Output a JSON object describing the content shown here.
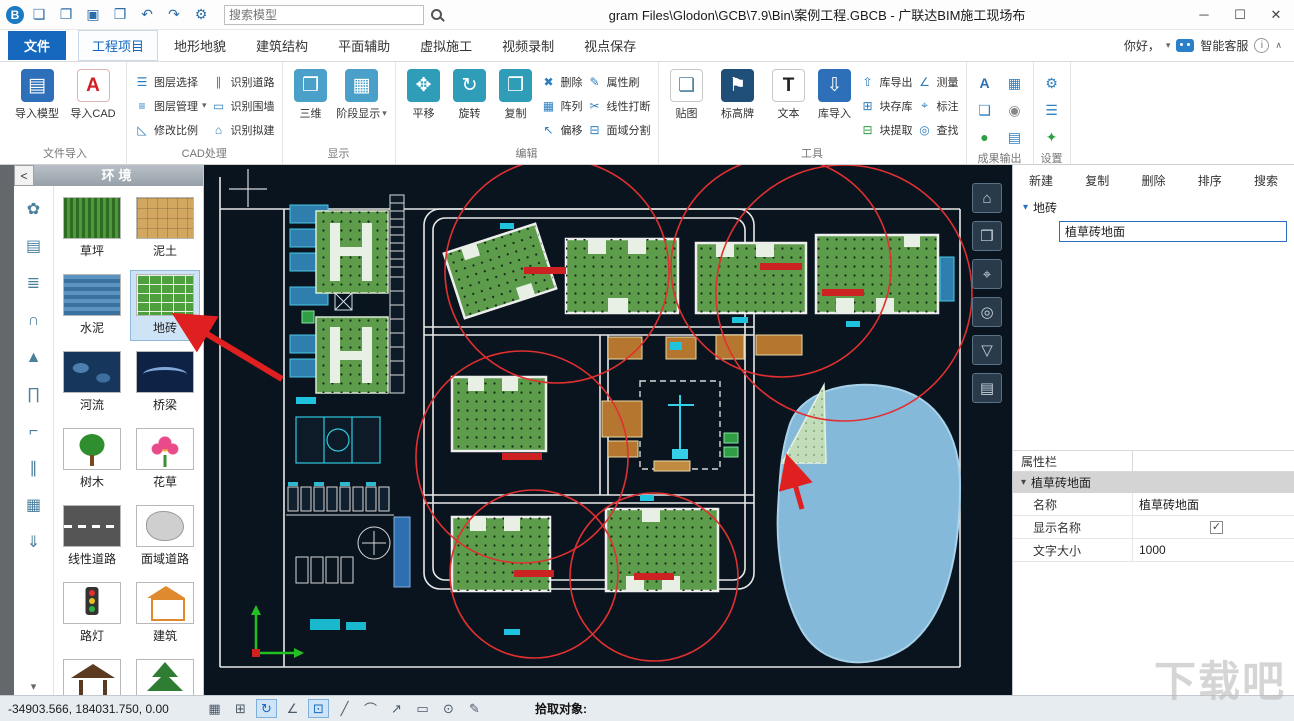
{
  "titlebar": {
    "logo": "B",
    "quick": [
      {
        "name": "new-file",
        "glyph": "❏"
      },
      {
        "name": "open-file",
        "glyph": "❐"
      },
      {
        "name": "save",
        "glyph": "▣"
      },
      {
        "name": "save-as",
        "glyph": "❒"
      },
      {
        "name": "undo",
        "glyph": "↶"
      },
      {
        "name": "redo",
        "glyph": "↷"
      },
      {
        "name": "settings",
        "glyph": "⚙"
      }
    ],
    "search_placeholder": "搜索模型",
    "title": "gram Files\\Glodon\\GCB\\7.9\\Bin\\案例工程.GBCB - 广联达BIM施工现场布",
    "window": {
      "minimize": "─",
      "maximize": "☐",
      "close": "✕"
    }
  },
  "tabbar": {
    "file": "文件",
    "tabs": [
      "工程项目",
      "地形地貌",
      "建筑结构",
      "平面辅助",
      "虚拟施工",
      "视频录制",
      "视点保存"
    ],
    "greeting": "你好，",
    "caret": "▾",
    "service": "智能客服",
    "info": "i",
    "collapse": "∧"
  },
  "ribbon": {
    "caret": "▾",
    "groups": [
      {
        "name": "文件导入",
        "big": [
          {
            "label": "导入模型",
            "glyph": "▤"
          },
          {
            "label": "导入CAD",
            "glyph": "A"
          }
        ]
      },
      {
        "name": "CAD处理",
        "small": [
          {
            "label": "图层选择",
            "glyph": "☰"
          },
          {
            "label": "图层管理",
            "glyph": "≡"
          },
          {
            "label": "修改比例",
            "glyph": "◺"
          },
          {
            "label": "识别道路",
            "glyph": "∥"
          },
          {
            "label": "识别围墙",
            "glyph": "▭"
          },
          {
            "label": "识别拟建",
            "glyph": "⌂"
          }
        ]
      },
      {
        "name": "显示",
        "big": [
          {
            "label": "三维",
            "glyph": "❒"
          },
          {
            "label": "阶段显示",
            "glyph": "▦"
          }
        ]
      },
      {
        "name": "编辑",
        "big": [
          {
            "label": "平移",
            "glyph": "✥"
          },
          {
            "label": "旋转",
            "glyph": "↻"
          },
          {
            "label": "复制",
            "glyph": "❐"
          }
        ],
        "small": [
          {
            "label": "删除",
            "glyph": "✖"
          },
          {
            "label": "阵列",
            "glyph": "▦"
          },
          {
            "label": "偏移",
            "glyph": "↖"
          },
          {
            "label": "属性刷",
            "glyph": "✎"
          },
          {
            "label": "线性打断",
            "glyph": "✂"
          },
          {
            "label": "面域分割",
            "glyph": "⊟"
          }
        ]
      },
      {
        "name": "工具",
        "big": [
          {
            "label": "贴图",
            "glyph": "❏"
          },
          {
            "label": "标高牌",
            "glyph": "⚑"
          },
          {
            "label": "文本",
            "glyph": "T"
          },
          {
            "label": "库导入",
            "glyph": "⇩"
          }
        ],
        "small": [
          {
            "label": "库导出",
            "glyph": "⇧"
          },
          {
            "label": "块存库",
            "glyph": "⊞"
          },
          {
            "label": "块提取",
            "glyph": "⊟"
          },
          {
            "label": "测量",
            "glyph": "∠"
          },
          {
            "label": "标注",
            "glyph": "⌖"
          },
          {
            "label": "查找",
            "glyph": "◎"
          }
        ]
      },
      {
        "name": "成果输出",
        "icons": [
          {
            "name": "text-output",
            "glyph": "A"
          },
          {
            "name": "doc-output",
            "glyph": "❏"
          },
          {
            "name": "model-output",
            "glyph": "●"
          },
          {
            "name": "image-output",
            "glyph": "▦"
          },
          {
            "name": "camera-output",
            "glyph": "◉"
          },
          {
            "name": "list-output",
            "glyph": "▤"
          }
        ]
      },
      {
        "name": "设置",
        "icons": [
          {
            "name": "gear",
            "glyph": "⚙"
          },
          {
            "name": "list",
            "glyph": "☰"
          },
          {
            "name": "options",
            "glyph": "✦"
          }
        ]
      }
    ]
  },
  "sidebar": {
    "back_glyph": "<",
    "title": "环境",
    "strip": [
      {
        "name": "plant",
        "glyph": "✿"
      },
      {
        "name": "building",
        "glyph": "▤"
      },
      {
        "name": "truss",
        "glyph": "≣"
      },
      {
        "name": "arch",
        "glyph": "∩"
      },
      {
        "name": "cone",
        "glyph": "▲"
      },
      {
        "name": "gate",
        "glyph": "∏"
      },
      {
        "name": "corner",
        "glyph": "⌐"
      },
      {
        "name": "pipe",
        "glyph": "∥"
      },
      {
        "name": "fence",
        "glyph": "▦"
      },
      {
        "name": "export",
        "glyph": "⇓"
      }
    ],
    "strip_more": "▾",
    "items": [
      {
        "label": "草坪"
      },
      {
        "label": "泥土"
      },
      {
        "label": "水泥"
      },
      {
        "label": "地砖",
        "selected": true
      },
      {
        "label": "河流"
      },
      {
        "label": "桥梁"
      },
      {
        "label": "树木"
      },
      {
        "label": "花草"
      },
      {
        "label": "线性道路"
      },
      {
        "label": "面域道路"
      },
      {
        "label": "路灯"
      },
      {
        "label": "建筑"
      },
      {
        "label": "凉亭"
      },
      {
        "label": "树"
      }
    ]
  },
  "canvas": {
    "view_tools": [
      {
        "name": "home-view",
        "glyph": "⌂"
      },
      {
        "name": "cube-view",
        "glyph": "❒"
      },
      {
        "name": "fit-view",
        "glyph": "⌖"
      },
      {
        "name": "zoom",
        "glyph": "◎"
      },
      {
        "name": "filter",
        "glyph": "▽"
      },
      {
        "name": "layers",
        "glyph": "▤"
      }
    ]
  },
  "right_panel": {
    "toolbar": [
      "新建",
      "复制",
      "删除",
      "排序",
      "搜索"
    ],
    "caret": "▾",
    "tree_group": "地砖",
    "tree_item": "植草砖地面",
    "properties_title": "属性栏",
    "properties_group": "植草砖地面",
    "props": [
      {
        "label": "名称",
        "value": "植草砖地面"
      },
      {
        "label": "显示名称",
        "checked": "✓"
      },
      {
        "label": "文字大小",
        "value": "1000"
      }
    ]
  },
  "statusbar": {
    "coordinates": "-34903.566, 184031.750,  0.00",
    "icons": [
      {
        "name": "grid",
        "glyph": "▦"
      },
      {
        "name": "snap",
        "glyph": "⊞"
      },
      {
        "name": "orbit",
        "glyph": "↻"
      },
      {
        "name": "angle",
        "glyph": "∠"
      },
      {
        "name": "osnap",
        "glyph": "⊡"
      },
      {
        "name": "line",
        "glyph": "╱"
      },
      {
        "name": "arc",
        "glyph": "⌒"
      },
      {
        "name": "vector",
        "glyph": "↗"
      },
      {
        "name": "rect",
        "glyph": "▭"
      },
      {
        "name": "circle",
        "glyph": "⊙"
      },
      {
        "name": "pen",
        "glyph": "✎"
      }
    ],
    "prompt": "拾取对象:"
  },
  "watermark": "下载吧"
}
